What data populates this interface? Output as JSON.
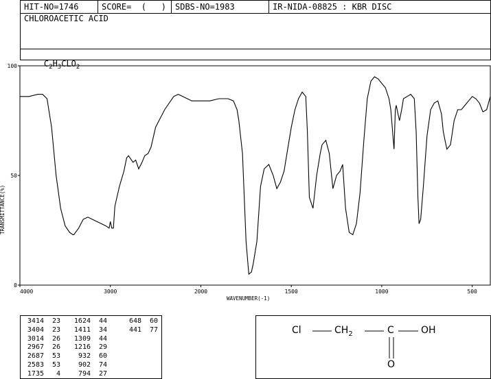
{
  "header": {
    "hit_no": "HIT-NO=1746",
    "score": "SCORE=  (   )",
    "sdbs_no": "SDBS-NO=1983",
    "ir_nida": "IR-NIDA-08825 : KBR DISC"
  },
  "compound": {
    "name": "CHLOROACETIC ACID",
    "formula_parts": [
      "C",
      "2",
      "H",
      "3",
      "CLO",
      "2"
    ]
  },
  "chart_data": {
    "type": "line",
    "xlabel": "WAVENUMBER(-1)",
    "ylabel": "TRANSMITTANCE(%)",
    "xlim": [
      4000,
      400
    ],
    "ylim": [
      0,
      100
    ],
    "x_ticks": [
      4000,
      3000,
      2000,
      1500,
      1000,
      500
    ],
    "x_tick_labels": [
      "4000",
      "3000",
      "2000",
      "1500",
      "1000",
      "500"
    ],
    "y_ticks": [
      0,
      50,
      100
    ],
    "y_tick_labels": [
      "0",
      "50",
      "100"
    ],
    "series": [
      {
        "x": [
          4000,
          3900,
          3800,
          3750,
          3700,
          3650,
          3600,
          3550,
          3500,
          3450,
          3414,
          3404,
          3350,
          3300,
          3250,
          3200,
          3150,
          3100,
          3050,
          3014,
          3000,
          2985,
          2967,
          2950,
          2900,
          2850,
          2820,
          2800,
          2750,
          2720,
          2687,
          2650,
          2620,
          2583,
          2550,
          2500,
          2400,
          2300,
          2250,
          2200,
          2150,
          2100,
          2050,
          2000,
          1950,
          1900,
          1850,
          1820,
          1800,
          1790,
          1770,
          1750,
          1735,
          1720,
          1710,
          1690,
          1670,
          1650,
          1624,
          1600,
          1580,
          1560,
          1540,
          1520,
          1500,
          1480,
          1460,
          1440,
          1420,
          1411,
          1400,
          1380,
          1360,
          1340,
          1330,
          1309,
          1290,
          1270,
          1250,
          1230,
          1216,
          1200,
          1180,
          1160,
          1140,
          1120,
          1100,
          1080,
          1060,
          1040,
          1020,
          1000,
          980,
          960,
          950,
          940,
          932,
          925,
          920,
          910,
          902,
          890,
          880,
          860,
          840,
          820,
          810,
          800,
          794,
          785,
          770,
          750,
          730,
          710,
          690,
          670,
          660,
          648,
          640,
          620,
          600,
          580,
          560,
          540,
          520,
          500,
          480,
          460,
          441,
          420,
          400
        ],
        "y": [
          86,
          86,
          87,
          87,
          85,
          72,
          50,
          35,
          27,
          24,
          23,
          23,
          26,
          30,
          31,
          30,
          29,
          28,
          27,
          26,
          29,
          26,
          26,
          36,
          45,
          52,
          58,
          59,
          56,
          57,
          53,
          56,
          59,
          60,
          63,
          72,
          80,
          86,
          87,
          86,
          85,
          84,
          84,
          84,
          84,
          85,
          85,
          84,
          80,
          75,
          60,
          20,
          5,
          6,
          10,
          20,
          45,
          53,
          55,
          50,
          44,
          47,
          52,
          62,
          72,
          80,
          85,
          88,
          86,
          70,
          40,
          35,
          50,
          60,
          64,
          66,
          60,
          44,
          50,
          52,
          55,
          35,
          24,
          23,
          28,
          42,
          65,
          85,
          93,
          95,
          94,
          92,
          90,
          85,
          80,
          70,
          62,
          80,
          82,
          78,
          75,
          80,
          85,
          86,
          87,
          85,
          70,
          40,
          28,
          30,
          45,
          68,
          80,
          83,
          84,
          78,
          70,
          65,
          62,
          64,
          75,
          80,
          80,
          82,
          84,
          86,
          85,
          83,
          79,
          80,
          86
        ]
      }
    ]
  },
  "peaks": [
    [
      [
        "3414",
        "23"
      ],
      [
        "3404",
        "23"
      ],
      [
        "3014",
        "26"
      ],
      [
        "2967",
        "26"
      ],
      [
        "2687",
        "53"
      ],
      [
        "2583",
        "53"
      ],
      [
        "1735",
        "4"
      ]
    ],
    [
      [
        "1624",
        "44"
      ],
      [
        "1411",
        "34"
      ],
      [
        "1309",
        "44"
      ],
      [
        "1216",
        "29"
      ],
      [
        "932",
        "60"
      ],
      [
        "902",
        "74"
      ],
      [
        "794",
        "27"
      ]
    ],
    [
      [
        "648",
        "60"
      ],
      [
        "441",
        "77"
      ]
    ]
  ],
  "structure": {
    "cl": "Cl",
    "ch2_base": "CH",
    "ch2_sub": "2",
    "c": "C",
    "oh": "OH",
    "o": "O"
  }
}
